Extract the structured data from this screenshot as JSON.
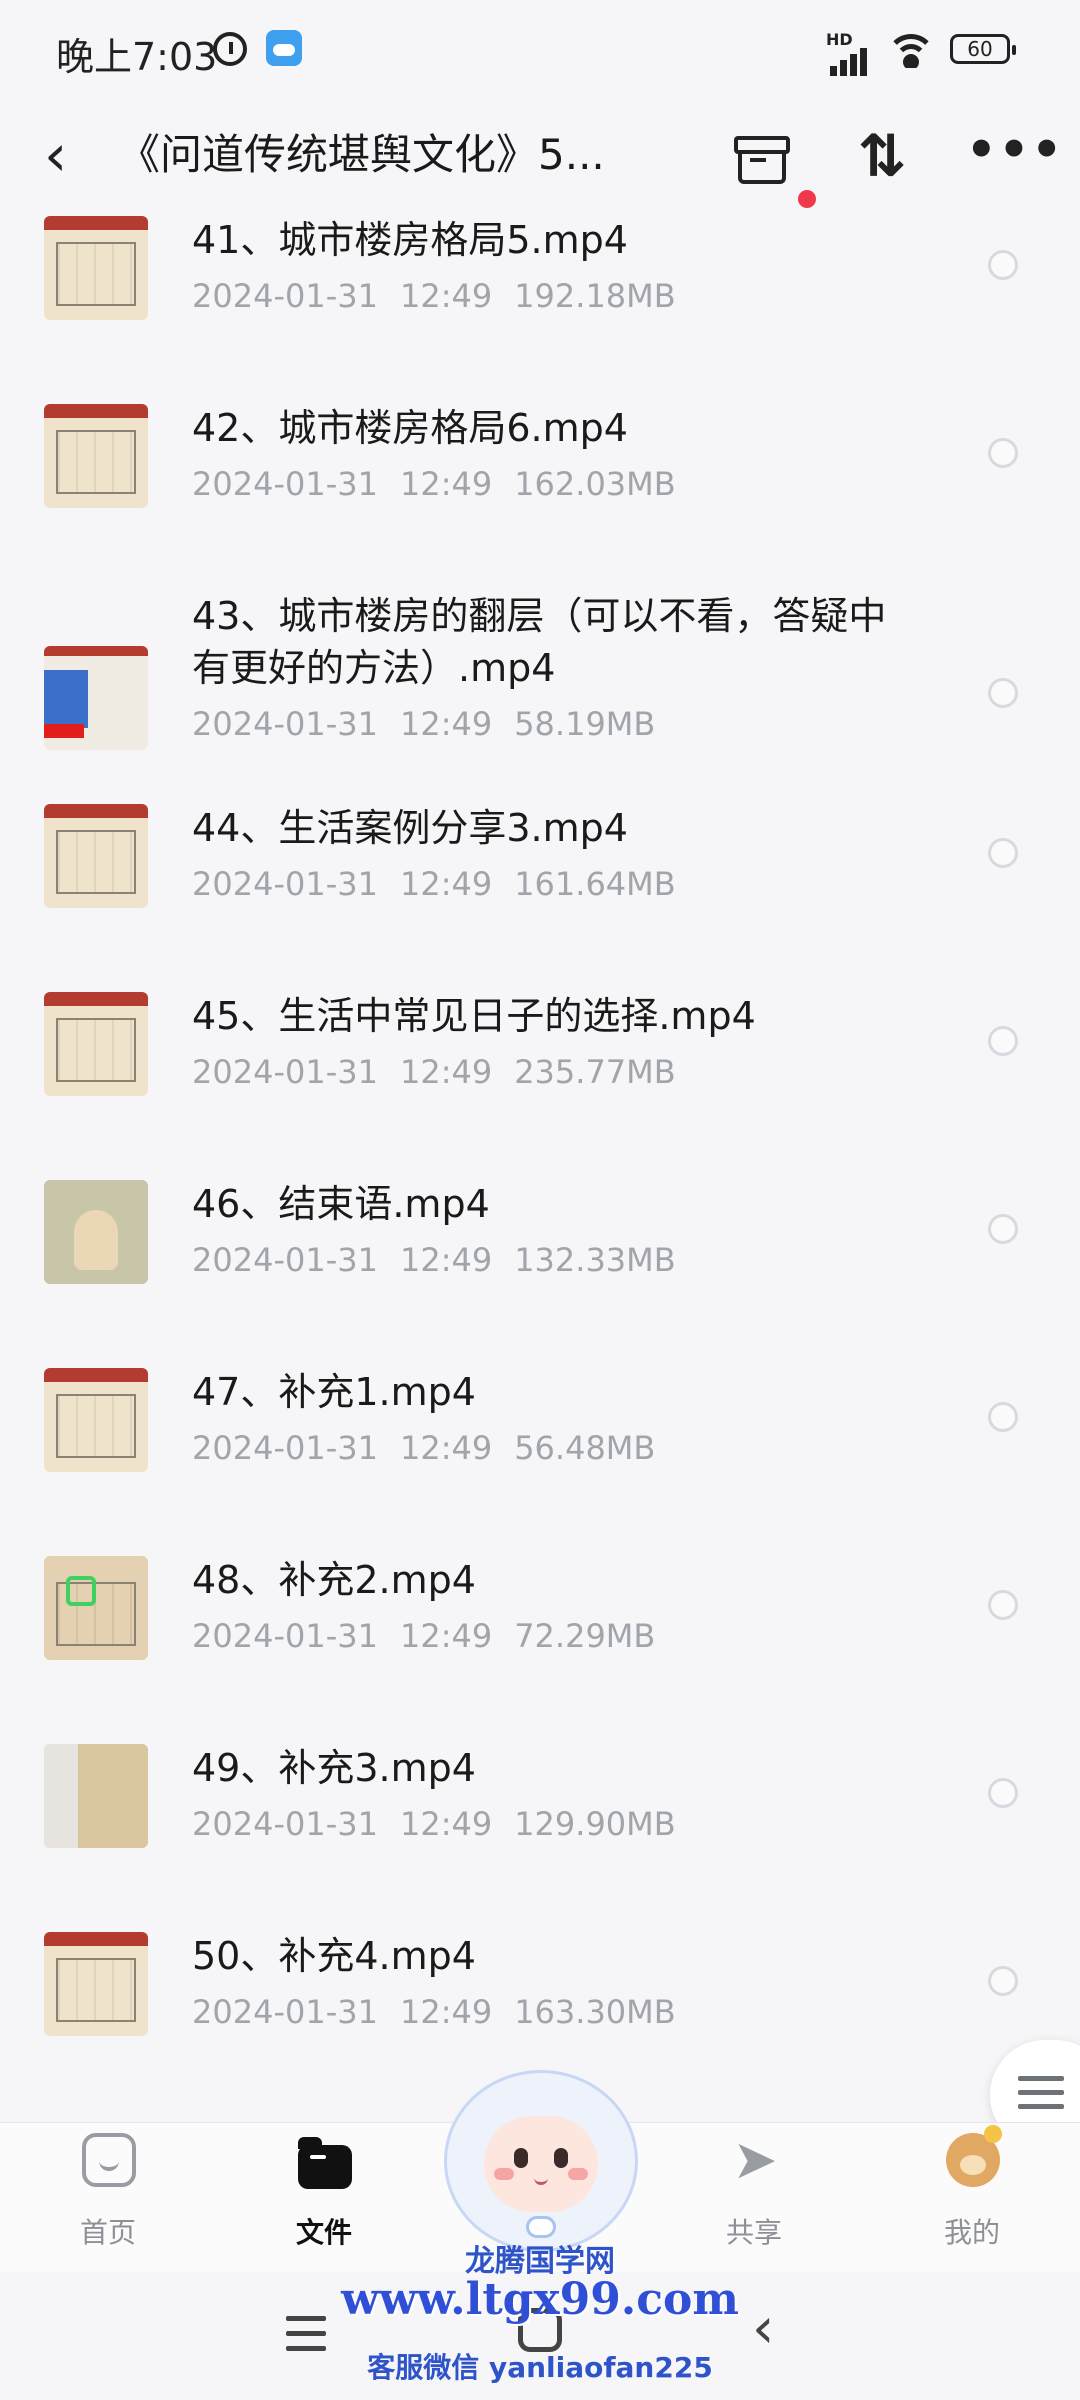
{
  "status_bar": {
    "time": "晚上7:03",
    "network": "HD",
    "battery": "60"
  },
  "header": {
    "title": "《问道传统堪舆文化》5..."
  },
  "files": [
    {
      "name": "41、城市楼房格局5.mp4",
      "date": "2024-01-31",
      "time": "12:49",
      "size": "192.18MB",
      "thumb": "floor-plan"
    },
    {
      "name": "42、城市楼房格局6.mp4",
      "date": "2024-01-31",
      "time": "12:49",
      "size": "162.03MB",
      "thumb": "floor-plan"
    },
    {
      "name": "43、城市楼房的翻层（可以不看，答疑中",
      "name2": "有更好的方法）.mp4",
      "date": "2024-01-31",
      "time": "12:49",
      "size": "58.19MB",
      "thumb": "blue-chart"
    },
    {
      "name": "44、生活案例分享3.mp4",
      "date": "2024-01-31",
      "time": "12:49",
      "size": "161.64MB",
      "thumb": "floor-plan"
    },
    {
      "name": "45、生活中常见日子的选择.mp4",
      "date": "2024-01-31",
      "time": "12:49",
      "size": "235.77MB",
      "thumb": "floor-plan"
    },
    {
      "name": "46、结束语.mp4",
      "date": "2024-01-31",
      "time": "12:49",
      "size": "132.33MB",
      "thumb": "person"
    },
    {
      "name": "47、补充1.mp4",
      "date": "2024-01-31",
      "time": "12:49",
      "size": "56.48MB",
      "thumb": "floor-plan"
    },
    {
      "name": "48、补充2.mp4",
      "date": "2024-01-31",
      "time": "12:49",
      "size": "72.29MB",
      "thumb": "green-mark"
    },
    {
      "name": "49、补充3.mp4",
      "date": "2024-01-31",
      "time": "12:49",
      "size": "129.90MB",
      "thumb": "white-side"
    },
    {
      "name": "50、补充4.mp4",
      "date": "2024-01-31",
      "time": "12:49",
      "size": "163.30MB",
      "thumb": "floor-plan"
    }
  ],
  "tabs": [
    {
      "label": "首页",
      "icon": "home-icon"
    },
    {
      "label": "文件",
      "icon": "folder-icon",
      "active": true
    },
    {
      "label": "共享",
      "icon": "share-icon"
    },
    {
      "label": "我的",
      "icon": "bear-avatar-icon"
    }
  ],
  "watermark": {
    "line1": "龙腾国学网",
    "line2": "www.ltgx99.com",
    "line3": "客服微信 yanliaofan225"
  },
  "colors": {
    "accent_dot": "#f0384b",
    "meta_text": "#a1a4ab",
    "watermark": "#2f4fd6"
  }
}
